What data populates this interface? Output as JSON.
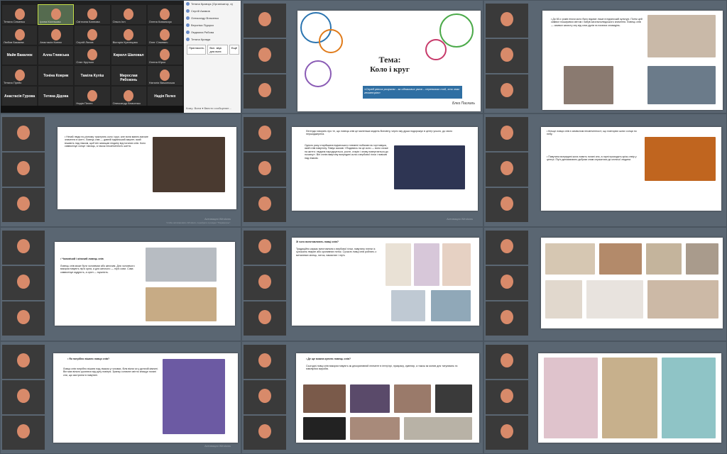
{
  "zoom": {
    "participants": [
      {
        "name": "Тетяна Семенко"
      },
      {
        "name": "Ірина Кісельова"
      },
      {
        "name": "Світлана Капнова"
      },
      {
        "name": "Ольга Ілл"
      },
      {
        "name": "Олена Ковальчук"
      },
      {
        "name": "Любов Бакаєва"
      },
      {
        "name": "Анастасія Конюх"
      },
      {
        "name": "Сергій Ляхов"
      },
      {
        "name": "Вікторія Кузнецова"
      },
      {
        "name": "Олег Сінкевич"
      },
      {
        "name": "",
        "big": "Майя Вакалюк"
      },
      {
        "name": "",
        "big": "Алла Гливська"
      },
      {
        "name": "Олег Крутько"
      },
      {
        "name": "",
        "big": "Кирилл Шаповал"
      },
      {
        "name": "Олена Юрко"
      },
      {
        "name": "Тетяна Прейс"
      },
      {
        "name": "",
        "big": "Тоніна Коврик"
      },
      {
        "name": "",
        "big": "Таміла Куліш"
      },
      {
        "name": "",
        "big": "Мирослав Рябоконь"
      },
      {
        "name": "Наталія Вишинська"
      },
      {
        "name": "",
        "big": "Анастасія Гурова"
      },
      {
        "name": "",
        "big": "Тетяна Дідова"
      },
      {
        "name": "Надія Пелех"
      },
      {
        "name": "Олександр Власенко"
      },
      {
        "name": "",
        "big": "Надія Пелех"
      }
    ],
    "panel_rows": [
      "Тетяна Кравчук (Організатор, я)",
      "Сергій Акимов",
      "Олександр Власенко",
      "Вероніка Підорко",
      "Людмила Рябова",
      "Тетяна Кривда"
    ],
    "panel_btns": [
      "Пригласить",
      "Вкл. звук для всех",
      "Ещё"
    ],
    "chat_note": "Кому: Всем ▾   Ввести сообщение..."
  },
  "slides": {
    "title": {
      "main": "Тема:",
      "sub": "Коло і круг",
      "quote": "«Серед рівних розумом - за однакових умов – переважає той, хто знає геометрію»",
      "author": "Блез Паскаль"
    },
    "s3": "• До 60-х років епохи коло було відоме лише в індіанській культурі. Потім цей символ поширився світом і набув загальнолюдського значення. Ловець снів — символ захисту сну від злих духів та поганих сновидінь.",
    "s4": "• Нехай люди по-різному трактують коло і круг, але вони мають вагоме значення в житті. Ловець снів — давній індіанський амулет, який вішають над ліжком, щоб він захищав людину від поганих снів. Коло символізує сонце і місяць, а також нескінченність життя.",
    "s5_head": "Легенда говорить про те, що ловець снів це маленька модель Всесвіту, через яку душа подорожує в центр усього, до свого першоджерела.",
    "s5": "Одного разу старійшина індіанського племені побачив на горі павука, який плів павутину. Павук сказав: «Подивись на це коло — воно схоже на життя: людина народжується, росте, старіє і знову повертається до початку». Він сплів павутину всередині кола з вербової гілки і повісив над ліжком.",
    "s6_head": "• Кільце ловця снів є символом нескінченності, що повторює шлях сонця по небу.",
    "s6": "• Павутина всередині кола ловить погані сни, а гарні проходять крізь отвір у центрі. Пір'я допомагають добрим снам спускатися до сплячої людини.",
    "s7_head": "• Чоловічий і жіночий ловець снів",
    "s7": "Ловець снів може бути чоловічим або жіночим. Для чоловічого використовують пір'я орла, а для жіночого — пір'я сови. Сова символізує мудрість, а орел — мужність.",
    "s8_head": "Зі чого виготовляють ловці снів?",
    "s8": "Традиційно каркас виготовляли з вербової гілки, павутину плели із сухожиль тварин або кропивних ниток. Сучасні ловці снів роблять з металевих кілець, ниток, намистин і пір'я.",
    "s10_head": "• Як потрібно вішати ловця снів?",
    "s10": "Ловця снів потрібно вішати над ліжком у головах, біля вікна чи у дитячій кімнаті. Він має вільно рухатися від руху повітря. Зранку сонячне світло знищує погані сни, що застрягли в павутині.",
    "s11_head": "• Де ще можна купити ловець снів?",
    "s11": "Сьогодні ловці снів використовують як декоративний елемент в інтер'єрі, прикрасу, сувенир, а також як мотив для татуювань та ювелірних виробів.",
    "watermark": "Активация Windows",
    "watermark2": "Чтобы активировать Windows, перейдите в раздел \"Параметры\"."
  },
  "colors": {
    "zoom_bg": "#1f1f1f",
    "panel_bg": "#f4f4f4",
    "quote_bg": "#2f6fa3",
    "slide_bg": "#ffffff"
  }
}
